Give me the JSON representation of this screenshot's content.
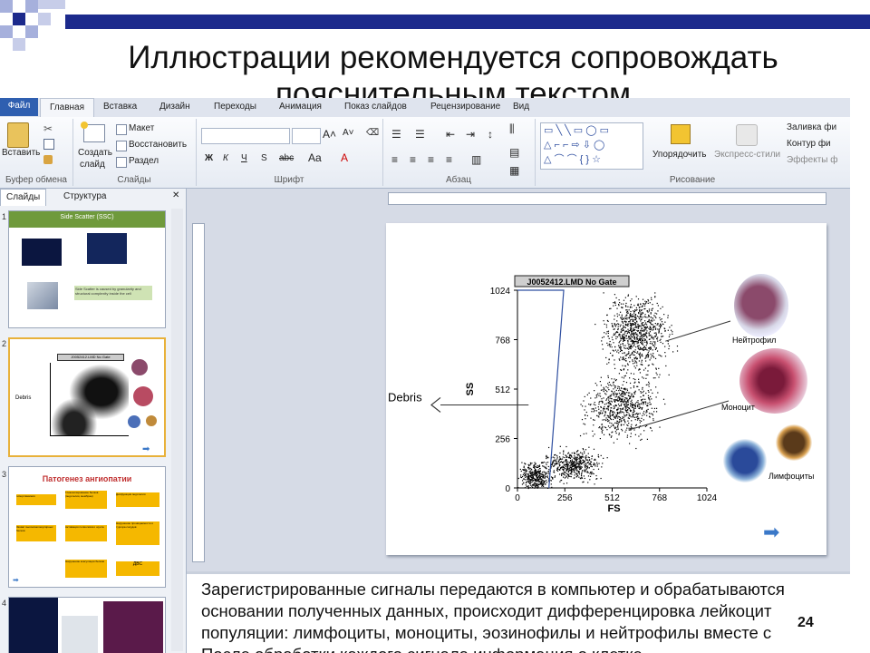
{
  "slide": {
    "title_line1": "Иллюстрации рекомендуется сопровождать",
    "title_line2": "пояснительным текстом",
    "page_number": "24"
  },
  "ribbon": {
    "tabs": [
      "Файл",
      "Главная",
      "Вставка",
      "Дизайн",
      "Переходы",
      "Анимация",
      "Показ слайдов",
      "Рецензирование",
      "Вид"
    ],
    "clipboard": {
      "paste_label": "Вставить",
      "group_label": "Буфер обмена"
    },
    "slides_group": {
      "create_label": "Создать",
      "create_label2": "слайд",
      "layout_label": "Макет",
      "reset_label": "Восстановить",
      "section_label": "Раздел",
      "group_label": "Слайды"
    },
    "font_group": {
      "bold": "Ж",
      "italic": "К",
      "underline": "Ч",
      "shadow": "S",
      "strike": "abc",
      "group_label": "Шрифт"
    },
    "paragraph_group": {
      "group_label": "Абзац"
    },
    "drawing_group": {
      "arrange_label": "Упорядочить",
      "quick_styles_label": "Экспресс-стили",
      "fill_label": "Заливка фи",
      "outline_label": "Контур фи",
      "effects_label": "Эффекты ф",
      "group_label": "Рисование"
    }
  },
  "sidebar": {
    "tab_slides": "Слайды",
    "tab_outline": "Структура",
    "thumbs": [
      {
        "num": "1",
        "title": "Side Scatter (SSC)",
        "caption": "Side Scatter is caused by granularity and structural complexity inside the cell"
      },
      {
        "num": "2",
        "title": "J0052412.LMD No Gate",
        "label": "Debris"
      },
      {
        "num": "3",
        "title": "Патогенез ангиопатии",
        "boxes": [
          "гипергликемия",
          "Гликозилирование белков (эндотелия, мембран)",
          "Дисфункция эндотелия",
          "Захват высокомолекулярных белков",
          "Активация полиолового шунта",
          "Нарушение проницаемости и тургора сосудов",
          "Нарушение коагуляции белков",
          "ДВС"
        ]
      },
      {
        "num": "4"
      }
    ]
  },
  "main_slide": {
    "plot_title": "J0052412.LMD No Gate",
    "debris_label": "Debris",
    "ylabel": "SS",
    "xlabel": "FS",
    "cells": [
      "Нейтрофил",
      "Моноцит",
      "Лимфоциты"
    ]
  },
  "chart_data": {
    "type": "scatter",
    "title": "J0052412.LMD No Gate",
    "xlabel": "FS",
    "ylabel": "SS",
    "x_ticks": [
      "0",
      "256",
      "512",
      "768",
      "1024"
    ],
    "y_ticks": [
      "0",
      "256",
      "512",
      "768",
      "1024"
    ],
    "xlim": [
      0,
      1024
    ],
    "ylim": [
      0,
      1024
    ],
    "clusters": [
      {
        "name": "Нейтрофил",
        "center": [
          640,
          800
        ],
        "spread": [
          130,
          150
        ]
      },
      {
        "name": "Моноцит",
        "center": [
          560,
          420
        ],
        "spread": [
          140,
          120
        ]
      },
      {
        "name": "Лимфоциты",
        "center": [
          300,
          120
        ],
        "spread": [
          110,
          60
        ]
      },
      {
        "name": "Debris",
        "center": [
          90,
          60
        ],
        "spread": [
          70,
          60
        ]
      }
    ]
  },
  "notes": {
    "line1": "Зарегистрированные сигналы передаются в компьютер и обрабатываются",
    "line2": "основании полученных данных, происходит дифференцировка лейкоцит",
    "line3": "популяции: лимфоциты, моноциты, эозинофилы и нейтрофилы вместе с",
    "line4": "После обработки каждого сигнала информация о клетке"
  },
  "colors": {
    "accent_blue": "#2f4fa0",
    "file_tab": "#2f5fb0",
    "deco_dark": "#1c2a8c",
    "deco_light": "#a6b0dc"
  }
}
